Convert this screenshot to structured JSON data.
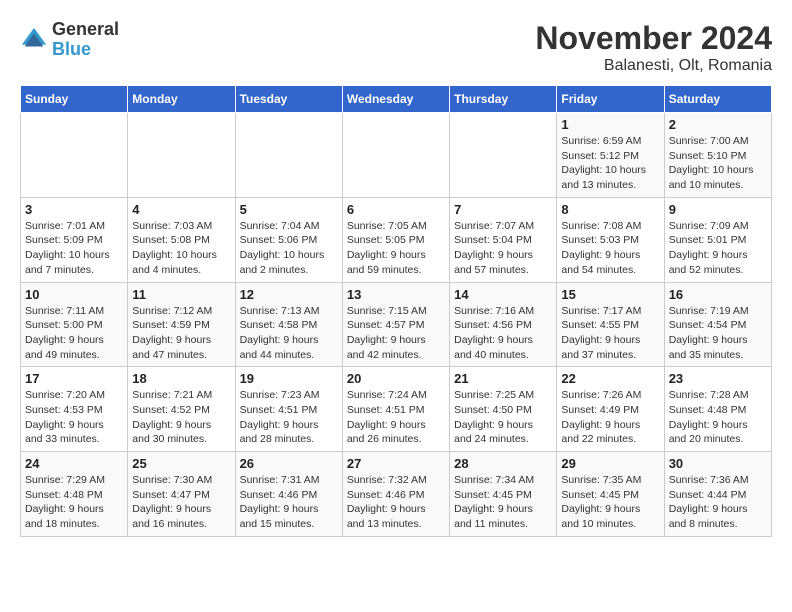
{
  "header": {
    "logo": {
      "line1": "General",
      "line2": "Blue"
    },
    "title": "November 2024",
    "subtitle": "Balanesti, Olt, Romania"
  },
  "weekdays": [
    "Sunday",
    "Monday",
    "Tuesday",
    "Wednesday",
    "Thursday",
    "Friday",
    "Saturday"
  ],
  "weeks": [
    [
      {
        "day": "",
        "info": ""
      },
      {
        "day": "",
        "info": ""
      },
      {
        "day": "",
        "info": ""
      },
      {
        "day": "",
        "info": ""
      },
      {
        "day": "",
        "info": ""
      },
      {
        "day": "1",
        "info": "Sunrise: 6:59 AM\nSunset: 5:12 PM\nDaylight: 10 hours and 13 minutes."
      },
      {
        "day": "2",
        "info": "Sunrise: 7:00 AM\nSunset: 5:10 PM\nDaylight: 10 hours and 10 minutes."
      }
    ],
    [
      {
        "day": "3",
        "info": "Sunrise: 7:01 AM\nSunset: 5:09 PM\nDaylight: 10 hours and 7 minutes."
      },
      {
        "day": "4",
        "info": "Sunrise: 7:03 AM\nSunset: 5:08 PM\nDaylight: 10 hours and 4 minutes."
      },
      {
        "day": "5",
        "info": "Sunrise: 7:04 AM\nSunset: 5:06 PM\nDaylight: 10 hours and 2 minutes."
      },
      {
        "day": "6",
        "info": "Sunrise: 7:05 AM\nSunset: 5:05 PM\nDaylight: 9 hours and 59 minutes."
      },
      {
        "day": "7",
        "info": "Sunrise: 7:07 AM\nSunset: 5:04 PM\nDaylight: 9 hours and 57 minutes."
      },
      {
        "day": "8",
        "info": "Sunrise: 7:08 AM\nSunset: 5:03 PM\nDaylight: 9 hours and 54 minutes."
      },
      {
        "day": "9",
        "info": "Sunrise: 7:09 AM\nSunset: 5:01 PM\nDaylight: 9 hours and 52 minutes."
      }
    ],
    [
      {
        "day": "10",
        "info": "Sunrise: 7:11 AM\nSunset: 5:00 PM\nDaylight: 9 hours and 49 minutes."
      },
      {
        "day": "11",
        "info": "Sunrise: 7:12 AM\nSunset: 4:59 PM\nDaylight: 9 hours and 47 minutes."
      },
      {
        "day": "12",
        "info": "Sunrise: 7:13 AM\nSunset: 4:58 PM\nDaylight: 9 hours and 44 minutes."
      },
      {
        "day": "13",
        "info": "Sunrise: 7:15 AM\nSunset: 4:57 PM\nDaylight: 9 hours and 42 minutes."
      },
      {
        "day": "14",
        "info": "Sunrise: 7:16 AM\nSunset: 4:56 PM\nDaylight: 9 hours and 40 minutes."
      },
      {
        "day": "15",
        "info": "Sunrise: 7:17 AM\nSunset: 4:55 PM\nDaylight: 9 hours and 37 minutes."
      },
      {
        "day": "16",
        "info": "Sunrise: 7:19 AM\nSunset: 4:54 PM\nDaylight: 9 hours and 35 minutes."
      }
    ],
    [
      {
        "day": "17",
        "info": "Sunrise: 7:20 AM\nSunset: 4:53 PM\nDaylight: 9 hours and 33 minutes."
      },
      {
        "day": "18",
        "info": "Sunrise: 7:21 AM\nSunset: 4:52 PM\nDaylight: 9 hours and 30 minutes."
      },
      {
        "day": "19",
        "info": "Sunrise: 7:23 AM\nSunset: 4:51 PM\nDaylight: 9 hours and 28 minutes."
      },
      {
        "day": "20",
        "info": "Sunrise: 7:24 AM\nSunset: 4:51 PM\nDaylight: 9 hours and 26 minutes."
      },
      {
        "day": "21",
        "info": "Sunrise: 7:25 AM\nSunset: 4:50 PM\nDaylight: 9 hours and 24 minutes."
      },
      {
        "day": "22",
        "info": "Sunrise: 7:26 AM\nSunset: 4:49 PM\nDaylight: 9 hours and 22 minutes."
      },
      {
        "day": "23",
        "info": "Sunrise: 7:28 AM\nSunset: 4:48 PM\nDaylight: 9 hours and 20 minutes."
      }
    ],
    [
      {
        "day": "24",
        "info": "Sunrise: 7:29 AM\nSunset: 4:48 PM\nDaylight: 9 hours and 18 minutes."
      },
      {
        "day": "25",
        "info": "Sunrise: 7:30 AM\nSunset: 4:47 PM\nDaylight: 9 hours and 16 minutes."
      },
      {
        "day": "26",
        "info": "Sunrise: 7:31 AM\nSunset: 4:46 PM\nDaylight: 9 hours and 15 minutes."
      },
      {
        "day": "27",
        "info": "Sunrise: 7:32 AM\nSunset: 4:46 PM\nDaylight: 9 hours and 13 minutes."
      },
      {
        "day": "28",
        "info": "Sunrise: 7:34 AM\nSunset: 4:45 PM\nDaylight: 9 hours and 11 minutes."
      },
      {
        "day": "29",
        "info": "Sunrise: 7:35 AM\nSunset: 4:45 PM\nDaylight: 9 hours and 10 minutes."
      },
      {
        "day": "30",
        "info": "Sunrise: 7:36 AM\nSunset: 4:44 PM\nDaylight: 9 hours and 8 minutes."
      }
    ]
  ]
}
